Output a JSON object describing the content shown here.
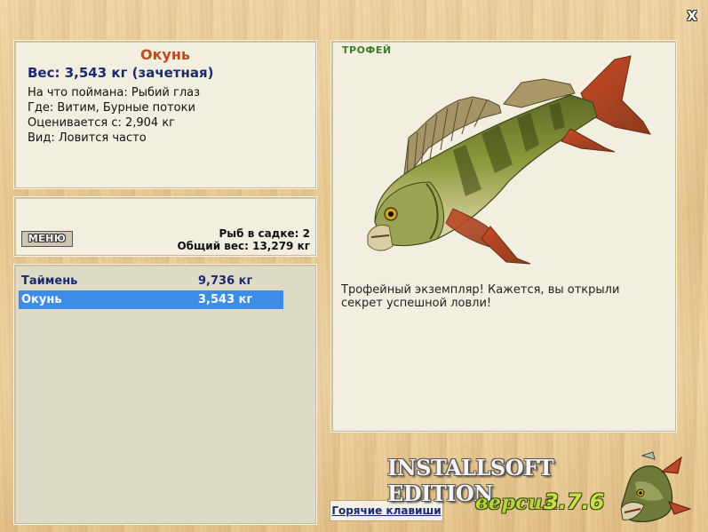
{
  "window": {
    "close_label": "X"
  },
  "fish_info": {
    "name": "Окунь",
    "weight": "Вес: 3,543 кг (зачетная)",
    "lines": [
      "На что поймана: Рыбий глаз",
      "Где: Витим, Бурные потоки",
      "Оценивается с: 2,904 кг",
      "Вид: Ловится часто"
    ]
  },
  "keeper": {
    "menu_label": "МЕНЮ",
    "fish_count": "Рыб в садке: 2",
    "total_weight": "Общий вес: 13,279 кг"
  },
  "catch_list": [
    {
      "name": "Таймень",
      "weight": "9,736 кг",
      "selected": false
    },
    {
      "name": "Окунь",
      "weight": "3,543 кг",
      "selected": true
    }
  ],
  "trophy": {
    "label": "ТРОФЕЙ",
    "text": "Трофейный экземпляр! Кажется, вы открыли секрет успешной ловли!"
  },
  "footer": {
    "hotkeys_label": "Горячие клавиши",
    "brand": "INSTALLSOFT EDITION",
    "version_word": "версия",
    "version_number": "3.7.6"
  },
  "icons": {
    "close": "close-icon",
    "fish": "perch-image",
    "logo": "pike-logo"
  }
}
